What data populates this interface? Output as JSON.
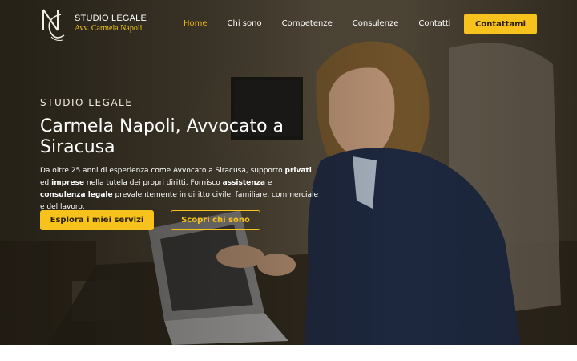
{
  "header": {
    "brand_title": "STUDIO LEGALE",
    "brand_subtitle": "Avv. Carmela Napoli",
    "logo_icon": "monogram-logo",
    "nav": [
      {
        "label": "Home",
        "active": true
      },
      {
        "label": "Chi sono",
        "active": false
      },
      {
        "label": "Competenze",
        "active": false
      },
      {
        "label": "Consulenze",
        "active": false
      },
      {
        "label": "Contatti",
        "active": false
      }
    ],
    "cta_label": "Contattami"
  },
  "hero": {
    "eyebrow": "STUDIO LEGALE",
    "title": "Carmela Napoli, Avvocato a Siracusa",
    "description": {
      "t1": "Da oltre 25 anni di esperienza come Avvocato a Siracusa, supporto ",
      "b1": "privati",
      "t2": " ed ",
      "b2": "imprese",
      "t3": " nella tutela dei propri diritti. Fornisco ",
      "b3": "assistenza",
      "t4": " e ",
      "b4": "consulenza legale",
      "t5": " prevalentemente in diritto civile, familiare, commerciale e del lavoro."
    },
    "primary_button": "Esplora i miei servizi",
    "secondary_button": "Scopri chi sono"
  },
  "colors": {
    "accent": "#f7c21c",
    "nav_active": "#f2b705",
    "text": "#ffffff"
  }
}
